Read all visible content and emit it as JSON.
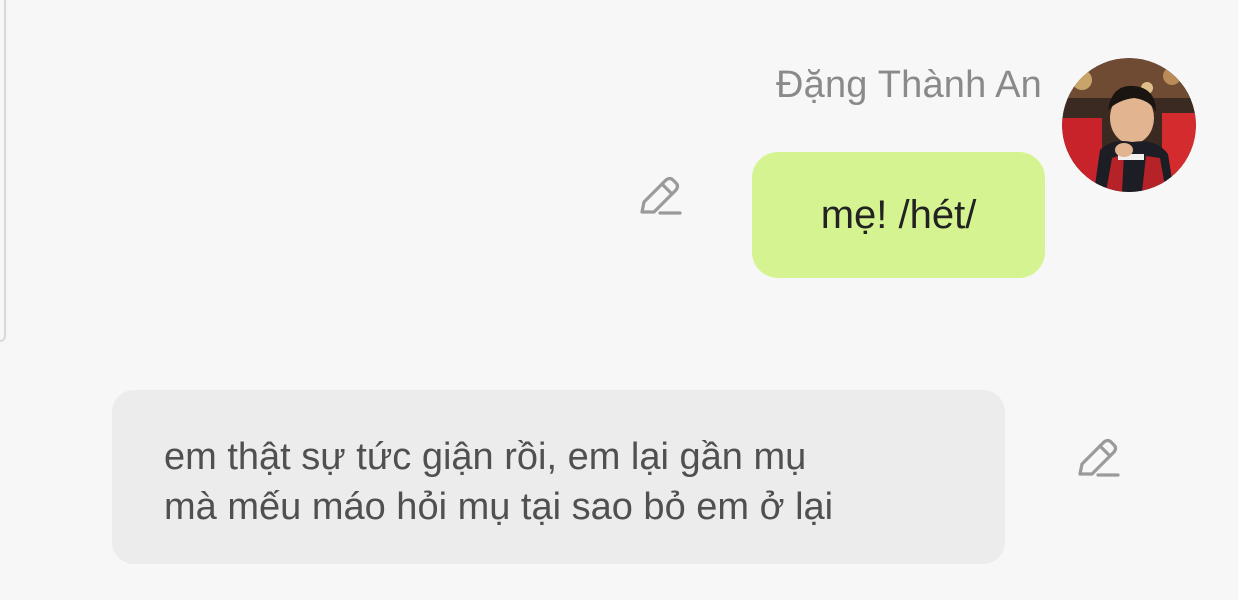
{
  "sender": {
    "name": "Đặng Thành An"
  },
  "messages": [
    {
      "direction": "outgoing",
      "text": "mẹ! /hét/",
      "bubble_color": "#d5f491",
      "action_icon": "pencil-edit-icon"
    },
    {
      "direction": "incoming",
      "lines": [
        "em thật sự tức giận rồi, em lại gần mụ",
        "mà mếu máo hỏi mụ tại sao bỏ em ở lại"
      ],
      "bubble_color": "#ececec",
      "action_icon": "pencil-edit-icon"
    }
  ],
  "colors": {
    "background": "#f7f7f7",
    "sender_name": "#8a8a8a",
    "icon": "#9a9a9a"
  }
}
